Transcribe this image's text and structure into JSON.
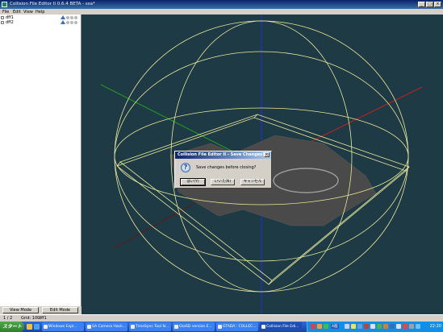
{
  "window": {
    "title": "Collision File Editor II 0.6.4 BETA - ssa*",
    "controls": {
      "minimize": "_",
      "maximize": "□",
      "close": "×"
    }
  },
  "menu": [
    "File",
    "Edit",
    "View",
    "Help"
  ],
  "tree": {
    "items": [
      {
        "label": "dff1",
        "checked": true
      },
      {
        "label": "dff2",
        "checked": true
      }
    ]
  },
  "sidebar_buttons": {
    "view_mode": "View Mode",
    "edit_mode": "Edit Mode"
  },
  "status": {
    "page": "1 / 2",
    "grid": "Grid: 100",
    "model": "dff1"
  },
  "dialog": {
    "title": "Collision File Editor II - Save Changes?",
    "message": "Save changes before closing?",
    "icon": "question-icon",
    "buttons": [
      "はい(Y)",
      "いいえ(N)",
      "キャンセル"
    ]
  },
  "taskbar": {
    "start_label": "スタート",
    "tasks": [
      {
        "label": "Windows Expl...",
        "active": false
      },
      {
        "label": "SA Camera Hack...",
        "active": false
      },
      {
        "label": "TimeSync Tool N...",
        "active": false
      },
      {
        "label": "GtaSD version E...",
        "active": false
      },
      {
        "label": "GTADA : COLLEC...",
        "active": false
      },
      {
        "label": "Collision File Edi...",
        "active": true
      }
    ],
    "ime": "A般",
    "clock": "22:20"
  },
  "colors": {
    "viewport_bg": "#1e3b45",
    "wireframe": "#e8e89a",
    "axis_x": "#c02020",
    "axis_y": "#20a020",
    "axis_z": "#2030d0",
    "mesh": "#4a4a4a"
  }
}
